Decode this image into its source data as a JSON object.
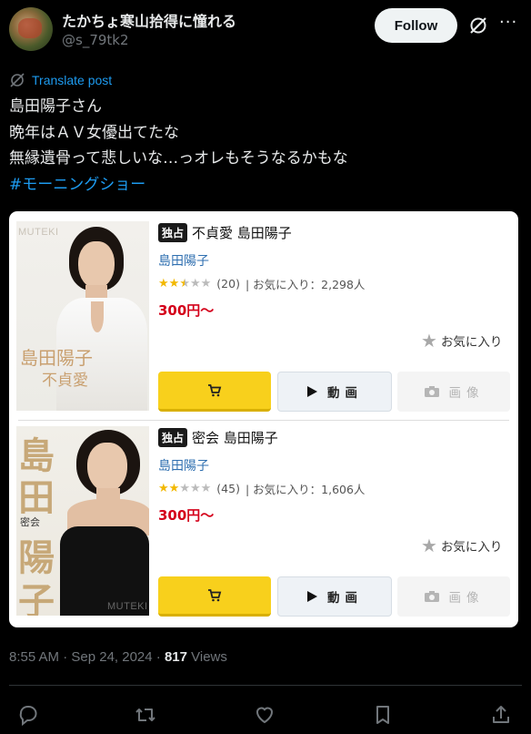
{
  "header": {
    "display_name": "たかちょ寒山拾得に憧れる",
    "handle": "@s_79tk2",
    "follow_label": "Follow"
  },
  "translate_label": "Translate post",
  "tweet": {
    "lines": [
      "島田陽子さん",
      "晩年はＡＶ女優出てたな",
      "無縁遺骨って悲しいな…っオレもそうなるかもな"
    ],
    "hashtag": "#モーニングショー"
  },
  "products": [
    {
      "badge": "独占",
      "title": "不貞愛 島田陽子",
      "actress": "島田陽子",
      "rating": 2.5,
      "review_count": "(20)",
      "favorites": "| お気に入り：2,298人",
      "price": "300円〜",
      "fav_label": "お気に入り",
      "video_label": "動画",
      "image_label": "画像",
      "cover": {
        "brand": "MUTEKI",
        "name": "島田陽子",
        "subtitle": "不貞愛"
      }
    },
    {
      "badge": "独占",
      "title": "密会 島田陽子",
      "actress": "島田陽子",
      "rating": 2,
      "review_count": "(45)",
      "favorites": "| お気に入り：1,606人",
      "price": "300円〜",
      "fav_label": "お気に入り",
      "video_label": "動画",
      "image_label": "画像",
      "cover": {
        "brand": "MUTEKI",
        "name_chars": [
          "島",
          "田",
          "陽",
          "子"
        ],
        "subtitle": "密会"
      }
    }
  ],
  "meta": {
    "time": "8:55 AM · Sep 24, 2024 · ",
    "views_count": "817",
    "views_label": " Views"
  },
  "icons": [
    "grok-icon",
    "more-icon",
    "translate-icon",
    "cart-icon",
    "play-icon",
    "camera-icon",
    "star-icon",
    "reply-icon",
    "repost-icon",
    "like-icon",
    "bookmark-icon",
    "share-icon"
  ],
  "colors": {
    "link": "#1d9bf0",
    "price": "#d4001a",
    "cart_button": "#f8d01c",
    "star": "#f2b800"
  }
}
